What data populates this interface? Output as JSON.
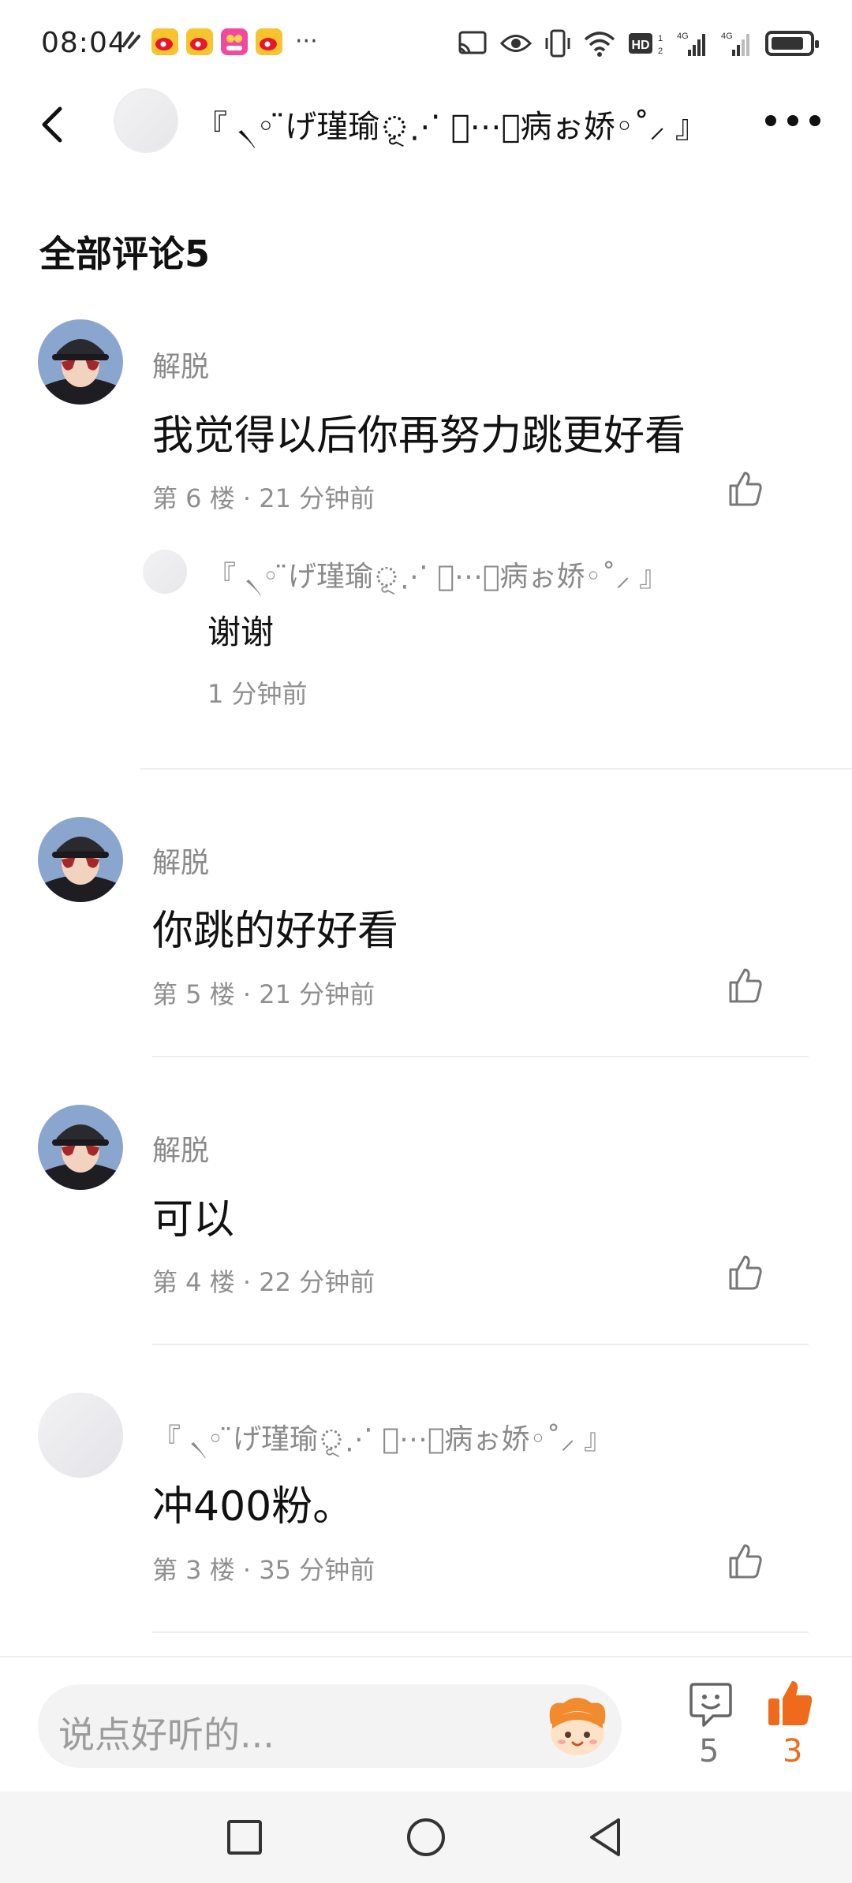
{
  "status_bar": {
    "time": "08:04",
    "overflow": "···",
    "app_icons": [
      "weibo-icon",
      "weibo-icon",
      "app-icon",
      "weibo-icon"
    ],
    "signal_labels": {
      "hd": "HD",
      "network1": "4G",
      "network2": "4G"
    }
  },
  "header": {
    "title": "『 ৲◦ ̈げ瑾瑜ূ⋰ ⃝⋯ূ病ぉ娇◦˚⸝ 』"
  },
  "section": {
    "title": "全部评论5"
  },
  "comments": [
    {
      "author": "解脱",
      "text": " 我觉得以后你再努力跳更好看",
      "meta": "第 6 楼 · 21 分钟前",
      "reply": {
        "author": "『 ৲◦ ̈げ瑾瑜ূ⋰ ⃝⋯ূ病ぉ娇◦˚⸝ 』",
        "text": "谢谢",
        "meta": "1 分钟前"
      }
    },
    {
      "author": "解脱",
      "text": "你跳的好好看",
      "meta": "第 5 楼 · 21 分钟前"
    },
    {
      "author": "解脱",
      "text": "可以",
      "meta": "第 4 楼 · 22 分钟前"
    },
    {
      "author": "『 ৲◦ ̈げ瑾瑜ূ⋰ ⃝⋯ূ病ぉ娇◦˚⸝ 』",
      "text": "冲400粉。",
      "meta": "第 3 楼 · 35 分钟前"
    }
  ],
  "bottom_bar": {
    "input_placeholder": "说点好听的...",
    "comment_count": "5",
    "like_count": "3",
    "accent_color": "#f06a1c"
  },
  "nav_bar": {
    "buttons": [
      "recent-apps-icon",
      "home-icon",
      "back-icon"
    ]
  }
}
